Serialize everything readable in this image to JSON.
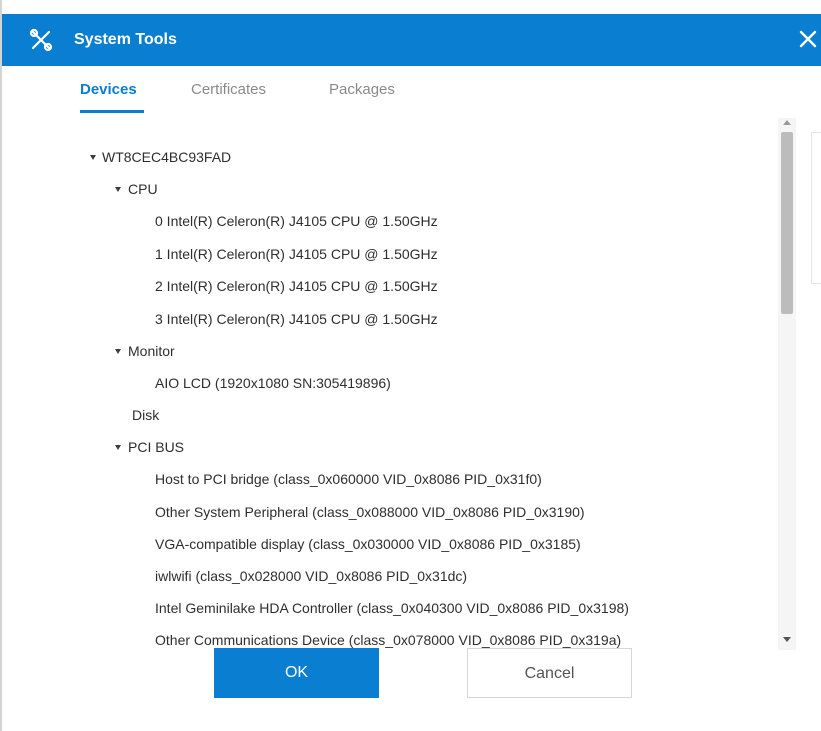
{
  "window": {
    "title": "System Tools",
    "accent_color": "#0a7ed0"
  },
  "tabs": [
    {
      "label": "Devices",
      "active": true
    },
    {
      "label": "Certificates",
      "active": false
    },
    {
      "label": "Packages",
      "active": false
    }
  ],
  "tree": {
    "root": "WT8CEC4BC93FAD",
    "cpu": {
      "label": "CPU",
      "items": [
        "0 Intel(R) Celeron(R) J4105 CPU @ 1.50GHz",
        "1 Intel(R) Celeron(R) J4105 CPU @ 1.50GHz",
        "2 Intel(R) Celeron(R) J4105 CPU @ 1.50GHz",
        "3 Intel(R) Celeron(R) J4105 CPU @ 1.50GHz"
      ]
    },
    "monitor": {
      "label": "Monitor",
      "items": [
        "AIO LCD (1920x1080 SN:305419896)"
      ]
    },
    "disk": {
      "label": "Disk"
    },
    "pci": {
      "label": "PCI BUS",
      "items": [
        "Host to PCI bridge (class_0x060000 VID_0x8086 PID_0x31f0)",
        "Other System Peripheral (class_0x088000 VID_0x8086 PID_0x3190)",
        "VGA-compatible display (class_0x030000 VID_0x8086 PID_0x3185)",
        "iwlwifi (class_0x028000 VID_0x8086 PID_0x31dc)",
        "Intel Geminilake HDA Controller (class_0x040300 VID_0x8086 PID_0x3198)",
        "Other Communications Device (class_0x078000 VID_0x8086 PID_0x319a)"
      ]
    }
  },
  "buttons": {
    "ok": "OK",
    "cancel": "Cancel"
  },
  "icons": {
    "app": "tools-icon",
    "close": "close-icon"
  }
}
